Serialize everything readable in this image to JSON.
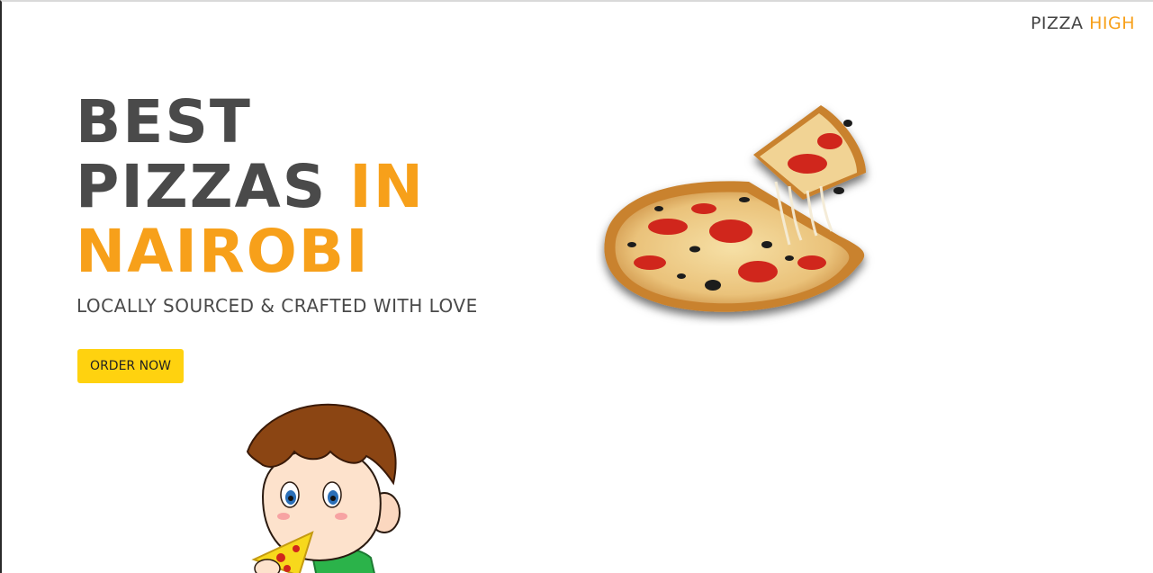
{
  "brand": {
    "name_main": "PIZZA",
    "name_accent": "HIGH",
    "accent_color": "#f7a01a"
  },
  "hero": {
    "title_line1": "BEST",
    "title_line2_main": "PIZZAS",
    "title_line2_accent": "IN",
    "title_line3_accent": "NAIROBI",
    "tagline": "LOCALLY SOURCED & CRAFTED WITH LOVE",
    "cta_label": "ORDER NOW",
    "cta_color": "#ffd20f",
    "text_color": "#4a4a4a"
  },
  "images": {
    "pizza": "pizza-slice-image",
    "kid": "boy-eating-pizza-illustration"
  }
}
